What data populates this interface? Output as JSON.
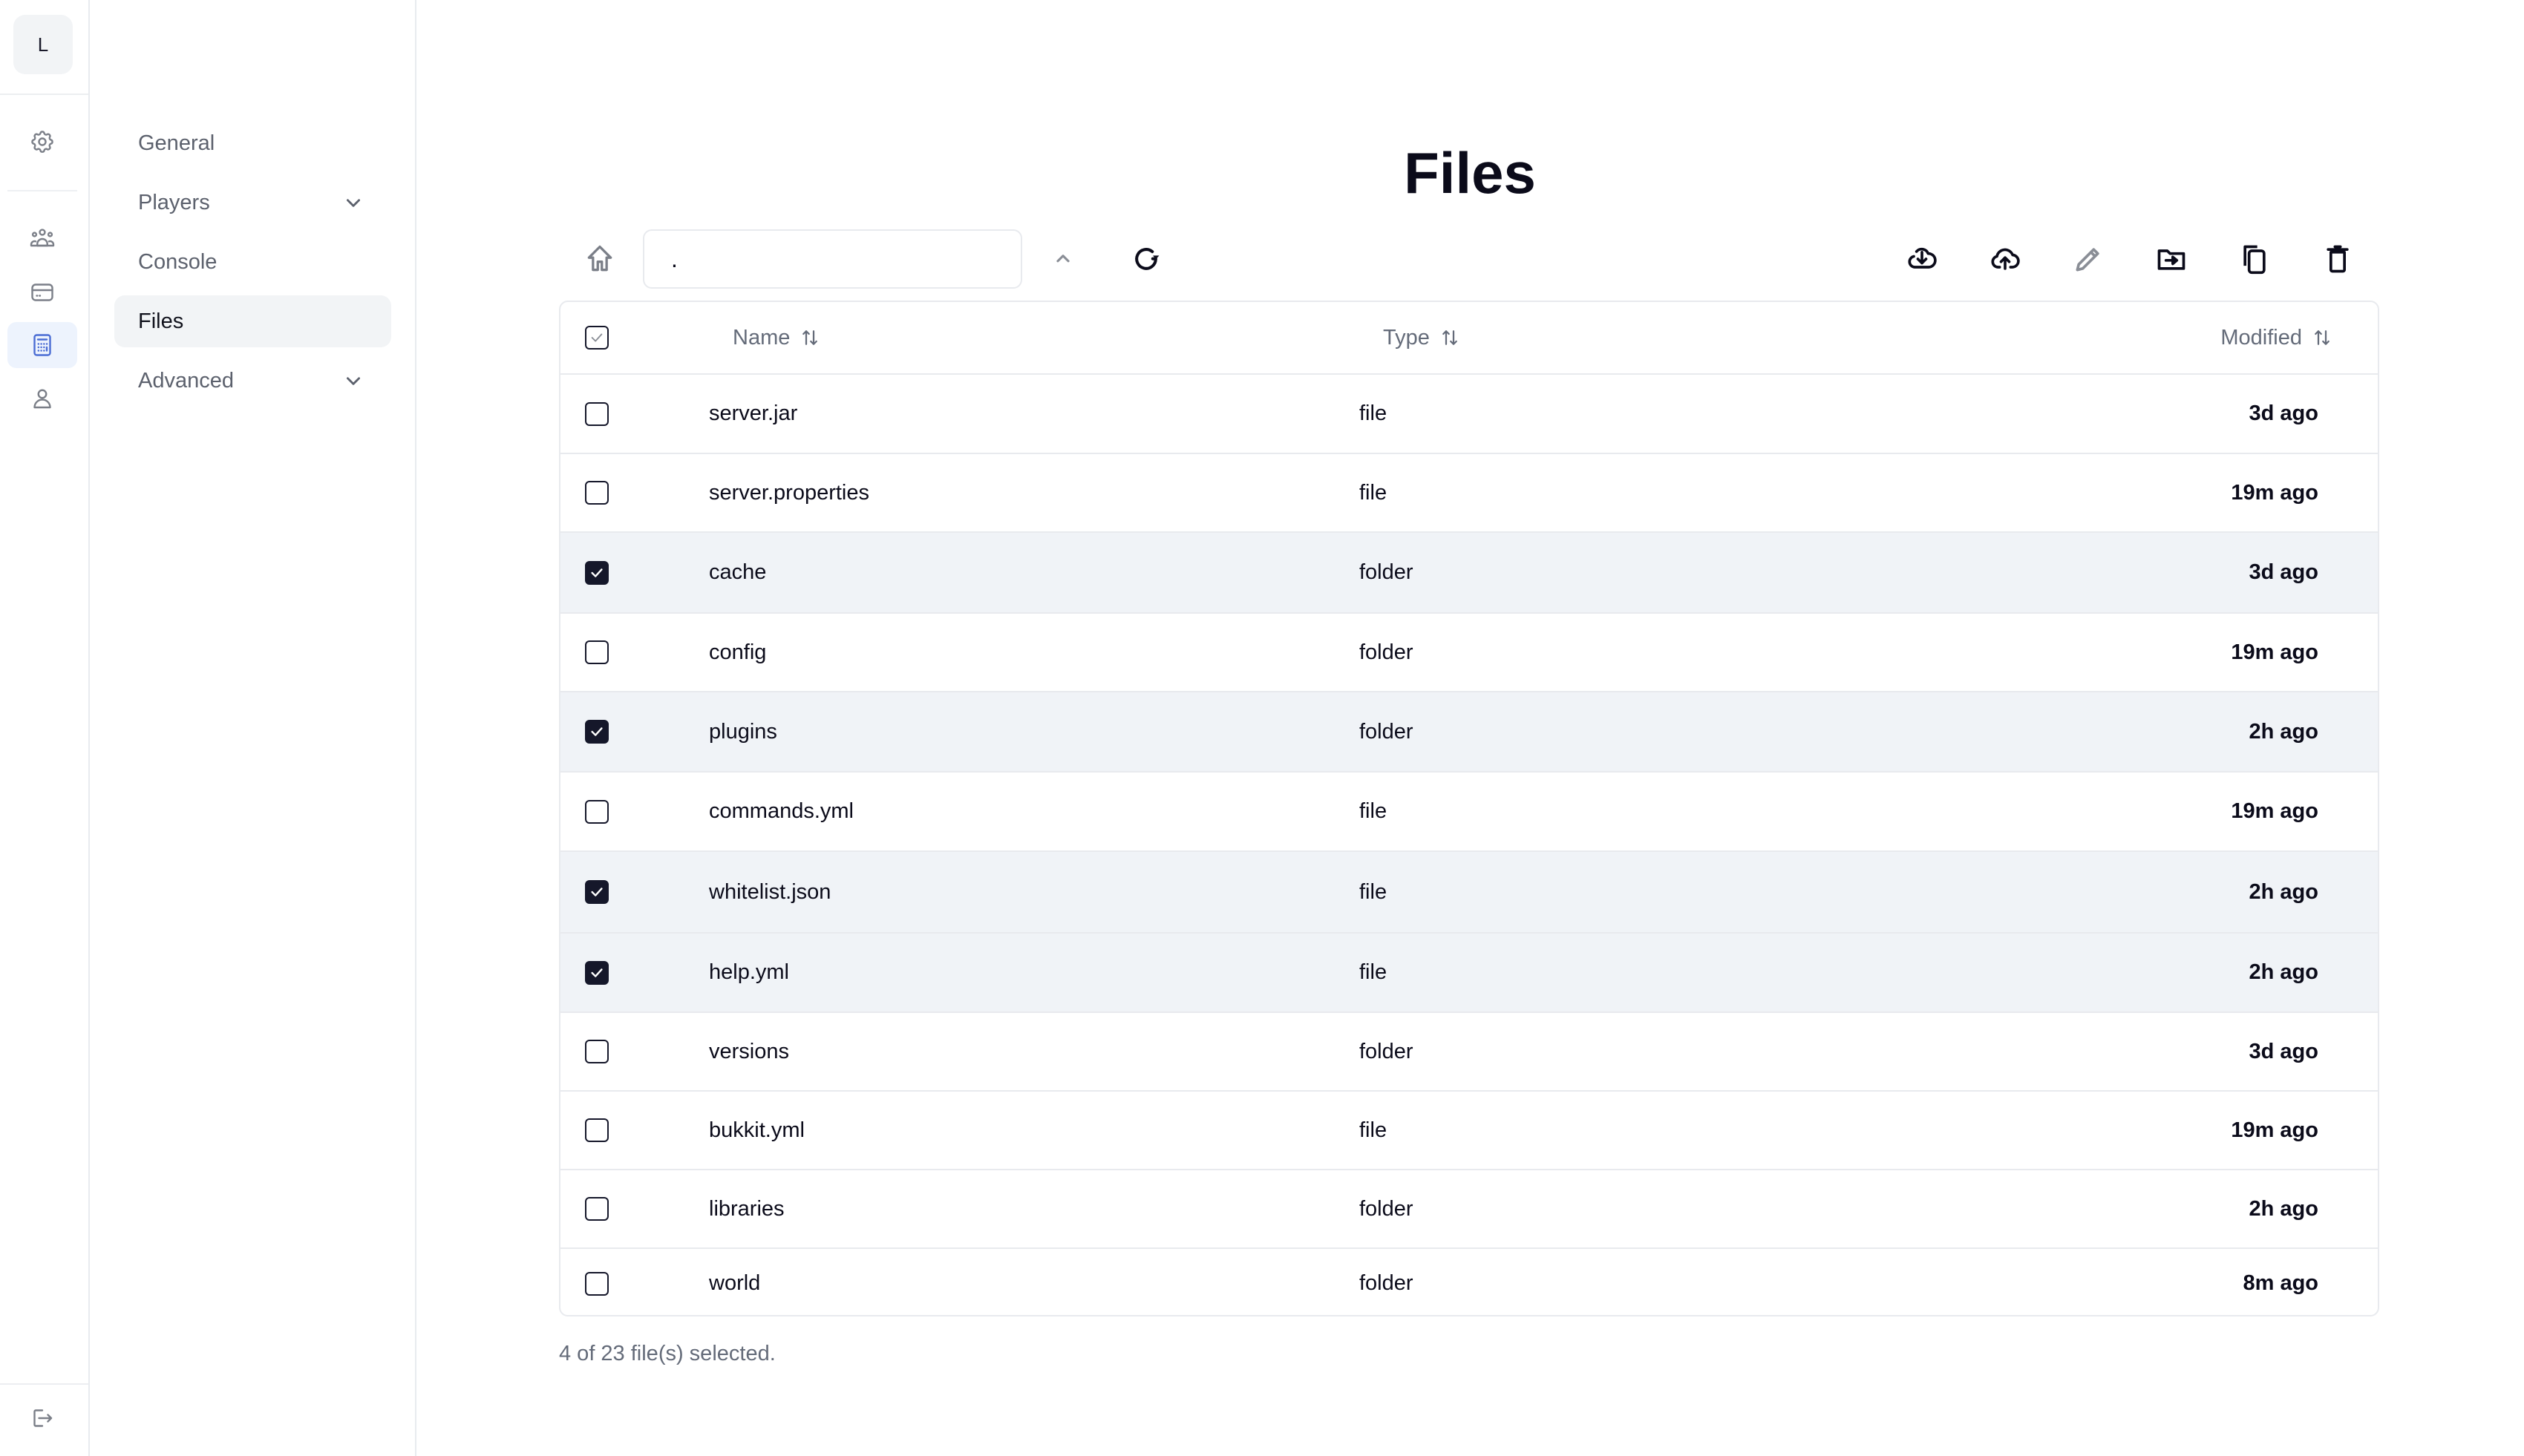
{
  "rail": {
    "avatar_letter": "L",
    "icons": [
      {
        "name": "settings-icon",
        "active": false
      },
      {
        "name": "users-group-icon",
        "active": false
      },
      {
        "name": "credit-card-icon",
        "active": false
      },
      {
        "name": "calculator-icon",
        "active": true
      },
      {
        "name": "user-icon",
        "active": false
      }
    ],
    "logout_icon": "logout-icon"
  },
  "subnav": {
    "items": [
      {
        "label": "General",
        "has_chevron": false,
        "active": false
      },
      {
        "label": "Players",
        "has_chevron": true,
        "active": false
      },
      {
        "label": "Console",
        "has_chevron": false,
        "active": false
      },
      {
        "label": "Files",
        "has_chevron": false,
        "active": true
      },
      {
        "label": "Advanced",
        "has_chevron": true,
        "active": false
      }
    ]
  },
  "page": {
    "title": "Files"
  },
  "toolbar": {
    "path_value": ".",
    "left_icons": [
      "home-icon",
      "chevron-up-icon",
      "refresh-icon"
    ],
    "right_icons": [
      {
        "name": "download-icon",
        "disabled": false
      },
      {
        "name": "upload-icon",
        "disabled": false
      },
      {
        "name": "rename-icon",
        "disabled": true
      },
      {
        "name": "move-icon",
        "disabled": false
      },
      {
        "name": "copy-icon",
        "disabled": false
      },
      {
        "name": "delete-icon",
        "disabled": false
      }
    ]
  },
  "table": {
    "columns": {
      "name": "Name",
      "type": "Type",
      "modified": "Modified"
    },
    "header_checkbox": "partial",
    "rows": [
      {
        "name": "server.jar",
        "type": "file",
        "modified": "3d ago",
        "selected": false
      },
      {
        "name": "server.properties",
        "type": "file",
        "modified": "19m ago",
        "selected": false
      },
      {
        "name": "cache",
        "type": "folder",
        "modified": "3d ago",
        "selected": true
      },
      {
        "name": "config",
        "type": "folder",
        "modified": "19m ago",
        "selected": false
      },
      {
        "name": "plugins",
        "type": "folder",
        "modified": "2h ago",
        "selected": true
      },
      {
        "name": "commands.yml",
        "type": "file",
        "modified": "19m ago",
        "selected": false
      },
      {
        "name": "whitelist.json",
        "type": "file",
        "modified": "2h ago",
        "selected": true
      },
      {
        "name": "help.yml",
        "type": "file",
        "modified": "2h ago",
        "selected": true
      },
      {
        "name": "versions",
        "type": "folder",
        "modified": "3d ago",
        "selected": false
      },
      {
        "name": "bukkit.yml",
        "type": "file",
        "modified": "19m ago",
        "selected": false
      },
      {
        "name": "libraries",
        "type": "folder",
        "modified": "2h ago",
        "selected": false
      },
      {
        "name": "world",
        "type": "folder",
        "modified": "8m ago",
        "selected": false
      }
    ]
  },
  "footer": {
    "selection_text": "4 of 23 file(s) selected."
  },
  "colors": {
    "accent": "#4a6cd4",
    "selected_row": "#f0f3f7",
    "checkbox": "#15172a"
  }
}
